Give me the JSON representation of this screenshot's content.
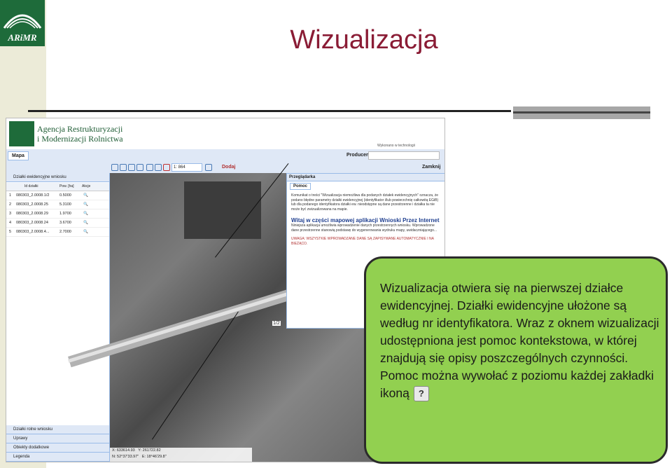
{
  "slide": {
    "title": "Wizualizacja",
    "logo_text": "ARiMR"
  },
  "app": {
    "agency_line1": "Agencja Restrukturyzacji",
    "agency_line2": "i Modernizacji Rolnictwa",
    "tech_text": "Wykonano w technologii",
    "tab_map": "Mapa",
    "producent_label": "Producent:",
    "scale_value": "1: 864",
    "add_label": "Dodaj",
    "close_label": "Zamknij"
  },
  "parcels_panel": {
    "title": "Działki ewidencyjne wniosku",
    "columns": [
      "Id działki",
      "Pow. [ha]",
      "Akcje"
    ],
    "rows": [
      {
        "n": "1",
        "id": "080303_2.0008.1/2",
        "area": "0.5000"
      },
      {
        "n": "2",
        "id": "080303_2.0008.25",
        "area": "5.3100"
      },
      {
        "n": "3",
        "id": "080303_2.0008.29",
        "area": "1.9700"
      },
      {
        "n": "4",
        "id": "080303_2.0008.24",
        "area": "3.6700"
      },
      {
        "n": "5",
        "id": "080303_2.0008.4...",
        "area": "2.7000"
      }
    ],
    "bottom_sections": [
      "Działki rolne wniosku",
      "Uprawy",
      "Obiekty dodatkowe",
      "Legenda"
    ]
  },
  "map": {
    "parcel_label": "1/2",
    "coord_x": "X: 633614.93",
    "coord_y": "Y: 261722.82",
    "coord_n": "N: 52°37'33.97\"",
    "coord_e": "E: 18°46'29.8\""
  },
  "browser": {
    "title": "Przeglądarka",
    "tab": "Pomoc",
    "message": "Komunikat o treści \"Wizualizacja niemożliwa dla podanych działek ewidencyjnych\" oznacza, że podano błędne parametry działki ewidencyjnej (identyfikator i/lub powierzchnię całkowitą EGiB) lub dla podanego identyfikatora działki ew. nieodstępne są dane przestrzenne i działka ta nie może być zwizualizowana na mapie.",
    "welcome": "Witaj w części mapowej aplikacji Wnioski Przez Internet",
    "body": "Niniejsza aplikacja umożliwia wprowadzenie danych przestrzennych wniosku. Wprowadzone dane przestrzenne stanowią podstawę do wygenerowania wydruku mapy, uwidaczniającego...",
    "note": "UWAGA: WSZYSTKIE WPROWADZANE DANE SĄ ZAPISYWANE AUTOMATYCZNIE I NA BIEŻĄCO."
  },
  "callout": {
    "text1": "Wizualizacja otwiera się na pierwszej działce ewidencyjnej. Działki ewidencyjne ułożone są według nr identyfikatora.",
    "text2": "Wraz z oknem wizualizacji udostępniona jest pomoc kontekstowa, w której znajdują się opisy poszczególnych czynności.",
    "text3": "Pomoc można wywołać z poziomu każdej zakładki ikoną",
    "icon_glyph": "?"
  }
}
